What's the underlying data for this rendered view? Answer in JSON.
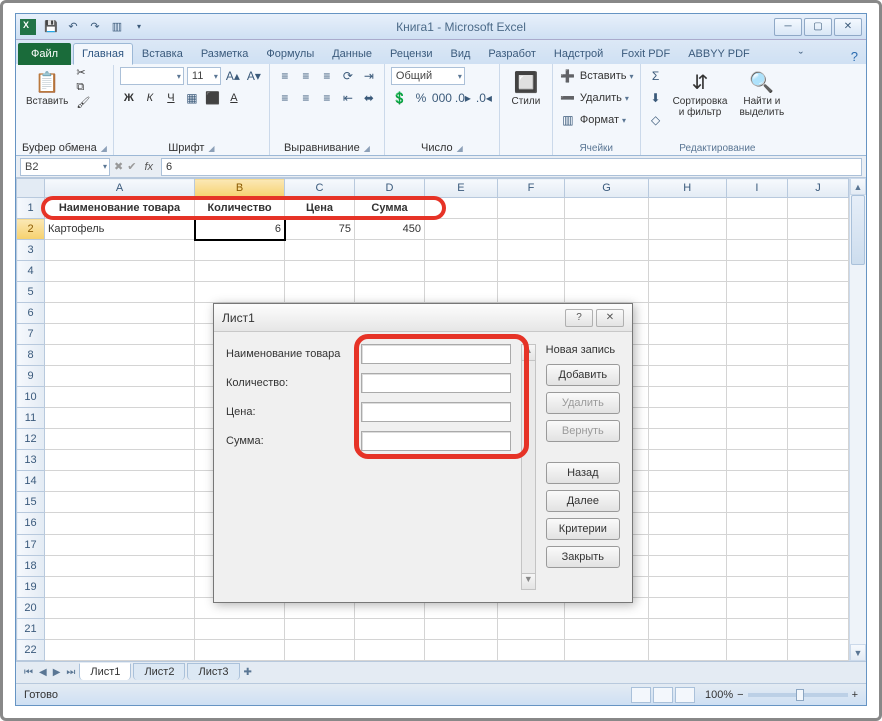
{
  "title": "Книга1 - Microsoft Excel",
  "tabs": {
    "file": "Файл",
    "home": "Главная",
    "insert": "Вставка",
    "layout": "Разметка",
    "formulas": "Формулы",
    "data": "Данные",
    "review": "Рецензи",
    "view": "Вид",
    "dev": "Разработ",
    "addins": "Надстрой",
    "foxit": "Foxit PDF",
    "abbyy": "ABBYY PDF"
  },
  "ribbon": {
    "paste": "Вставить",
    "clipboard_label": "Буфер обмена",
    "font_label": "Шрифт",
    "align_label": "Выравнивание",
    "number_label": "Число",
    "styles": "Стили",
    "cells_label": "Ячейки",
    "insert": "Вставить",
    "delete": "Удалить",
    "format": "Формат",
    "sort": "Сортировка\nи фильтр",
    "find": "Найти и\nвыделить",
    "editing_label": "Редактирование",
    "font_size": "11",
    "numfmt": "Общий"
  },
  "namebox": "B2",
  "formula": "6",
  "cols": [
    "A",
    "B",
    "C",
    "D",
    "E",
    "F",
    "G",
    "H",
    "I",
    "J"
  ],
  "headers": {
    "a": "Наименование товара",
    "b": "Количество",
    "c": "Цена",
    "d": "Сумма"
  },
  "row": {
    "a": "Картофель",
    "b": "6",
    "c": "75",
    "d": "450"
  },
  "sheets": {
    "s1": "Лист1",
    "s2": "Лист2",
    "s3": "Лист3"
  },
  "status": "Готово",
  "zoom": "100%",
  "dialog": {
    "title": "Лист1",
    "f1": "Наименование товара",
    "f2": "Количество:",
    "f3": "Цена:",
    "f4": "Сумма:",
    "newrec": "Новая запись",
    "add": "Добавить",
    "del": "Удалить",
    "restore": "Вернуть",
    "prev": "Назад",
    "next": "Далее",
    "criteria": "Критерии",
    "close": "Закрыть"
  }
}
